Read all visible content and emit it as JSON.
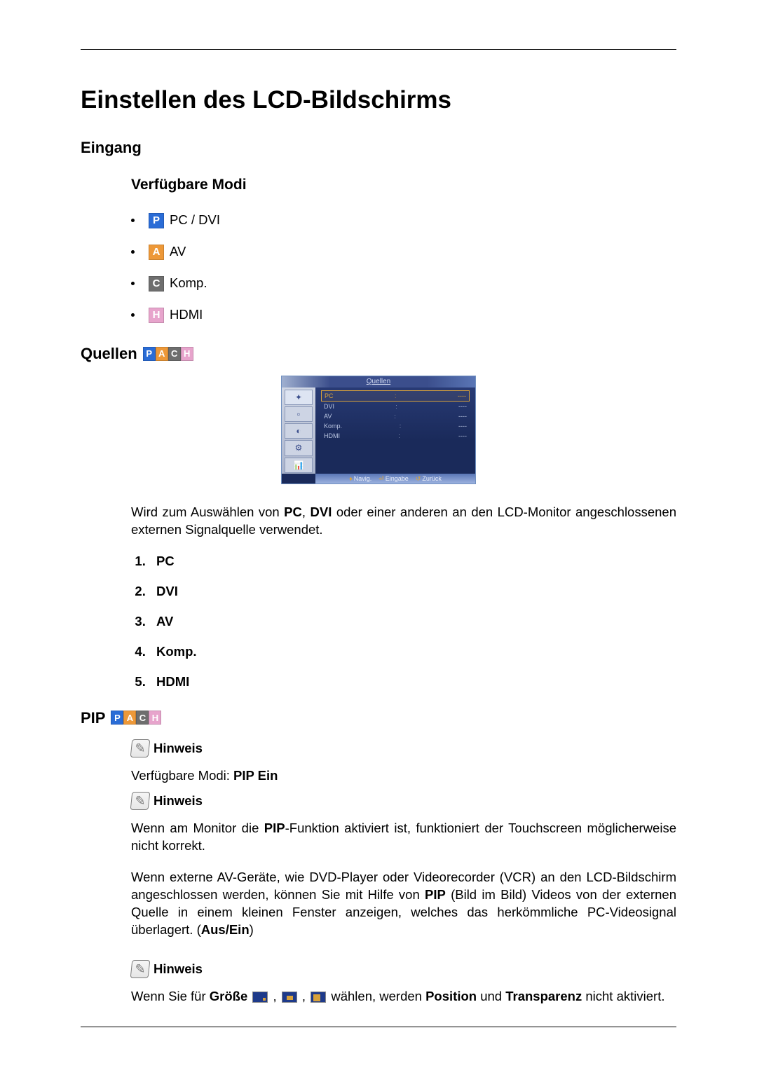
{
  "title": "Einstellen des LCD-Bildschirms",
  "sections": {
    "eingang": {
      "heading": "Eingang",
      "sub_heading": "Verfügbare Modi",
      "modes": [
        {
          "badge": "P",
          "color": "blue",
          "label": "PC / DVI"
        },
        {
          "badge": "A",
          "color": "orange",
          "label": "AV"
        },
        {
          "badge": "C",
          "color": "gray",
          "label": "Komp."
        },
        {
          "badge": "H",
          "color": "pink",
          "label": "HDMI"
        }
      ]
    },
    "quellen": {
      "heading": "Quellen",
      "badge_strip": [
        "P",
        "A",
        "C",
        "H"
      ],
      "osd": {
        "title": "Quellen",
        "rows": [
          {
            "label": "PC",
            "value": "----",
            "selected": true
          },
          {
            "label": "DVI",
            "value": "----",
            "selected": false
          },
          {
            "label": "AV",
            "value": "----",
            "selected": false
          },
          {
            "label": "Komp.",
            "value": "----",
            "selected": false
          },
          {
            "label": "HDMI",
            "value": "----",
            "selected": false
          }
        ],
        "footer": {
          "navig": "Navig.",
          "eingabe": "Eingabe",
          "zurueck": "Zurück"
        }
      },
      "desc_pre": "Wird zum Auswählen von ",
      "desc_bold1": "PC",
      "desc_mid1": ", ",
      "desc_bold2": "DVI",
      "desc_post": " oder einer anderen an den LCD-Monitor angeschlossenen externen Signalquelle verwendet.",
      "list": [
        "PC",
        "DVI",
        "AV",
        "Komp.",
        "HDMI"
      ]
    },
    "pip": {
      "heading": "PIP",
      "badge_strip": [
        "P",
        "A",
        "C",
        "H"
      ],
      "hinweis_label": "Hinweis",
      "avail_pre": "Verfügbare Modi: ",
      "avail_bold": "PIP Ein",
      "note2_pre": "Wenn am Monitor die ",
      "note2_bold": "PIP",
      "note2_post": "-Funktion aktiviert ist, funktioniert der Touchscreen möglicherweise nicht korrekt.",
      "para3_a": "Wenn externe AV-Geräte, wie DVD-Player oder Videorecorder (VCR) an den LCD-Bildschirm angeschlossen werden, können Sie mit Hilfe von ",
      "para3_b_bold": "PIP",
      "para3_c": " (Bild im Bild) Videos von der externen Quelle in einem kleinen Fenster anzeigen, welches das herkömmliche PC-Videosignal überlagert. (",
      "para3_d_bold": "Aus/Ein",
      "para3_e": ")",
      "note3_a": "Wenn Sie für ",
      "note3_b_bold": "Größe",
      "note3_c": " , ",
      "note3_d": " , ",
      "note3_e": " wählen, werden ",
      "note3_f_bold": "Position",
      "note3_g": " und ",
      "note3_h_bold": "Transparenz",
      "note3_i": " nicht aktiviert."
    }
  }
}
